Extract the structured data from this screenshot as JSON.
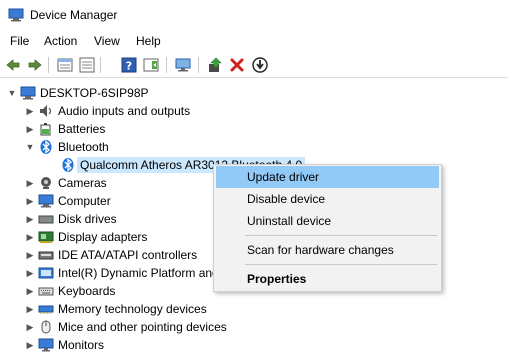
{
  "window": {
    "title": "Device Manager"
  },
  "menu": [
    "File",
    "Action",
    "View",
    "Help"
  ],
  "toolbar": {
    "buttons": [
      "back-icon",
      "forward-icon",
      "properties-icon",
      "properties-sheet-icon",
      "help-icon",
      "action-pane-icon",
      "monitor-scan-icon",
      "update-driver-icon",
      "uninstall-icon",
      "download-icon"
    ]
  },
  "tree": {
    "root": "DESKTOP-6SIP98P",
    "items": [
      {
        "label": "Audio inputs and outputs",
        "icon": "speaker-icon"
      },
      {
        "label": "Batteries",
        "icon": "battery-icon"
      },
      {
        "label": "Bluetooth",
        "icon": "bluetooth-icon",
        "expanded": true
      },
      {
        "label": "Qualcomm Atheros AR3012 Bluetooth 4.0",
        "icon": "bluetooth-icon",
        "selected": true
      },
      {
        "label": "Cameras",
        "icon": "camera-icon"
      },
      {
        "label": "Computer",
        "icon": "computer-icon"
      },
      {
        "label": "Disk drives",
        "icon": "disk-icon"
      },
      {
        "label": "Display adapters",
        "icon": "display-adapter-icon"
      },
      {
        "label": "IDE ATA/ATAPI controllers",
        "icon": "ide-controller-icon"
      },
      {
        "label": "Intel(R) Dynamic Platform and Thermal Framework",
        "icon": "chip-icon"
      },
      {
        "label": "Keyboards",
        "icon": "keyboard-icon"
      },
      {
        "label": "Memory technology devices",
        "icon": "memory-icon"
      },
      {
        "label": "Mice and other pointing devices",
        "icon": "mouse-icon"
      },
      {
        "label": "Monitors",
        "icon": "monitor-icon"
      }
    ]
  },
  "context_menu": {
    "update": "Update driver",
    "disable": "Disable device",
    "uninstall": "Uninstall device",
    "scan": "Scan for hardware changes",
    "properties": "Properties"
  }
}
